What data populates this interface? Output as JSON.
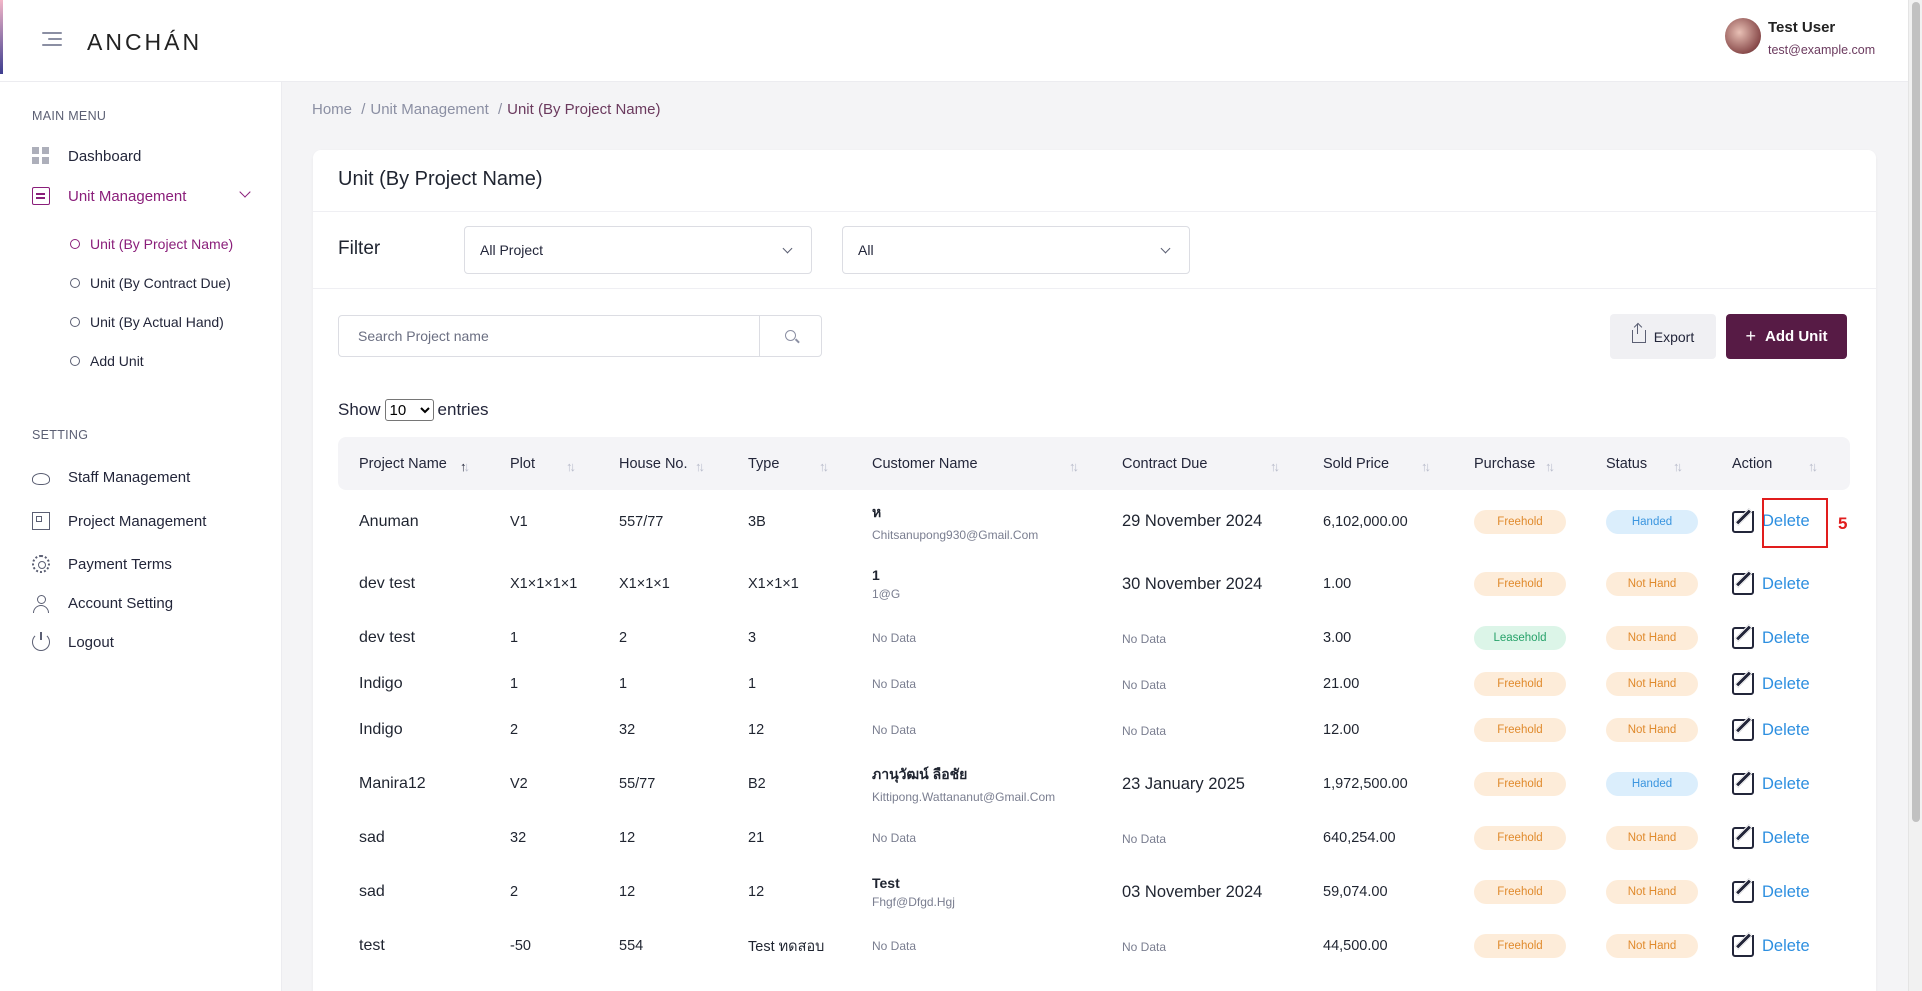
{
  "header": {
    "logo": "ANCHÁN",
    "user_name": "Test User",
    "user_email": "test@example.com"
  },
  "sidebar": {
    "main_menu_title": "MAIN MENU",
    "dashboard": "Dashboard",
    "unit_management": "Unit Management",
    "sub_items": [
      "Unit (By Project Name)",
      "Unit (By Contract Due)",
      "Unit (By Actual Hand)",
      "Add Unit"
    ],
    "setting_title": "SETTING",
    "staff": "Staff Management",
    "project": "Project Management",
    "payment": "Payment Terms",
    "account": "Account Setting",
    "logout": "Logout"
  },
  "breadcrumb": {
    "home": "Home",
    "unit_management": "Unit Management",
    "current": "Unit (By Project Name)",
    "separator": "/"
  },
  "card": {
    "title": "Unit (By Project Name)",
    "filter_label": "Filter",
    "filter_project": "All Project",
    "filter_status": "All",
    "search_placeholder": "Search Project name",
    "export_label": "Export",
    "add_label": "Add Unit",
    "show_label": "Show",
    "show_value": "10",
    "entries_label": "entries"
  },
  "table": {
    "columns": [
      "Project Name",
      "Plot",
      "House No.",
      "Type",
      "Customer Name",
      "Contract Due",
      "Sold Price",
      "Purchase",
      "Status",
      "Action"
    ],
    "no_data": "No Data",
    "delete_label": "Delete",
    "rows": [
      {
        "project": "Anuman",
        "plot": "V1",
        "house": "557/77",
        "type": "3B",
        "cust_name": "ห",
        "cust_email": "Chitsanupong930@Gmail.Com",
        "contract": "29 November 2024",
        "price": "6,102,000.00",
        "purchase": "Freehold",
        "status": "Handed"
      },
      {
        "project": "dev test",
        "plot": "X1×1×1×1",
        "house": "X1×1×1",
        "type": "X1×1×1",
        "cust_name": "1",
        "cust_email": "1@G",
        "contract": "30 November 2024",
        "price": "1.00",
        "purchase": "Freehold",
        "status": "Not Hand"
      },
      {
        "project": "dev test",
        "plot": "1",
        "house": "2",
        "type": "3",
        "cust_name": "",
        "cust_email": "",
        "contract": "",
        "price": "3.00",
        "purchase": "Leasehold",
        "status": "Not Hand"
      },
      {
        "project": "Indigo",
        "plot": "1",
        "house": "1",
        "type": "1",
        "cust_name": "",
        "cust_email": "",
        "contract": "",
        "price": "21.00",
        "purchase": "Freehold",
        "status": "Not Hand"
      },
      {
        "project": "Indigo",
        "plot": "2",
        "house": "32",
        "type": "12",
        "cust_name": "",
        "cust_email": "",
        "contract": "",
        "price": "12.00",
        "purchase": "Freehold",
        "status": "Not Hand"
      },
      {
        "project": "Manira12",
        "plot": "V2",
        "house": "55/77",
        "type": "B2",
        "cust_name": "ภานุวัฒน์ ลือชัย",
        "cust_email": "Kittipong.Wattananut@Gmail.Com",
        "contract": "23 January 2025",
        "price": "1,972,500.00",
        "purchase": "Freehold",
        "status": "Handed"
      },
      {
        "project": "sad",
        "plot": "32",
        "house": "12",
        "type": "21",
        "cust_name": "",
        "cust_email": "",
        "contract": "",
        "price": "640,254.00",
        "purchase": "Freehold",
        "status": "Not Hand"
      },
      {
        "project": "sad",
        "plot": "2",
        "house": "12",
        "type": "12",
        "cust_name": "Test",
        "cust_email": "Fhgf@Dfgd.Hgj",
        "contract": "03 November 2024",
        "price": "59,074.00",
        "purchase": "Freehold",
        "status": "Not Hand"
      },
      {
        "project": "test",
        "plot": "-50",
        "house": "554",
        "type": "Test ทดสอบ",
        "cust_name": "",
        "cust_email": "",
        "contract": "",
        "price": "44,500.00",
        "purchase": "Freehold",
        "status": "Not Hand"
      }
    ]
  },
  "annotation": {
    "label": "5",
    "color": "#e11d1d"
  },
  "colors": {
    "brand": "#571b45",
    "accent": "#8a1e7a",
    "link": "#2d8fe0"
  }
}
